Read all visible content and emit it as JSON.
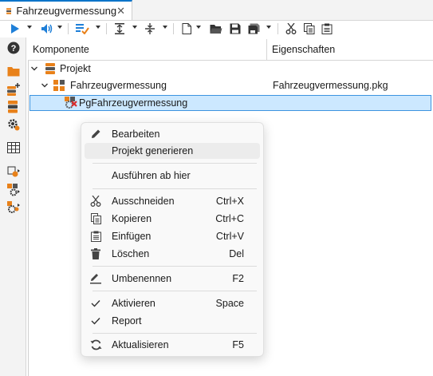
{
  "tab": {
    "title": "Fahrzeugvermessung",
    "close": "✕"
  },
  "tree": {
    "columns": [
      "Komponente",
      "Eigenschaften"
    ],
    "rows": [
      {
        "label": "Projekt",
        "property": ""
      },
      {
        "label": "Fahrzeugvermessung",
        "property": "Fahrzeugvermessung.pkg"
      },
      {
        "label": "PgFahrzeugvermessung",
        "property": ""
      }
    ]
  },
  "menu": {
    "items": [
      {
        "label": "Bearbeiten",
        "shortcut": "",
        "icon": "pencil-icon"
      },
      {
        "label": "Projekt generieren",
        "shortcut": "",
        "icon": ""
      },
      {
        "label": "Ausführen ab hier",
        "shortcut": "",
        "icon": ""
      },
      {
        "label": "Ausschneiden",
        "shortcut": "Ctrl+X",
        "icon": "scissors-icon"
      },
      {
        "label": "Kopieren",
        "shortcut": "Ctrl+C",
        "icon": "copy-icon"
      },
      {
        "label": "Einfügen",
        "shortcut": "Ctrl+V",
        "icon": "paste-icon"
      },
      {
        "label": "Löschen",
        "shortcut": "Del",
        "icon": "trash-icon"
      },
      {
        "label": "Umbenennen",
        "shortcut": "F2",
        "icon": "rename-icon"
      },
      {
        "label": "Aktivieren",
        "shortcut": "Space",
        "icon": "check-icon"
      },
      {
        "label": "Report",
        "shortcut": "",
        "icon": "check-icon"
      },
      {
        "label": "Aktualisieren",
        "shortcut": "F5",
        "icon": "refresh-icon"
      }
    ]
  },
  "colors": {
    "accent": "#0a74c9",
    "selection": "#cce8ff",
    "selection_border": "#3d94e0",
    "orange": "#e8811a"
  }
}
